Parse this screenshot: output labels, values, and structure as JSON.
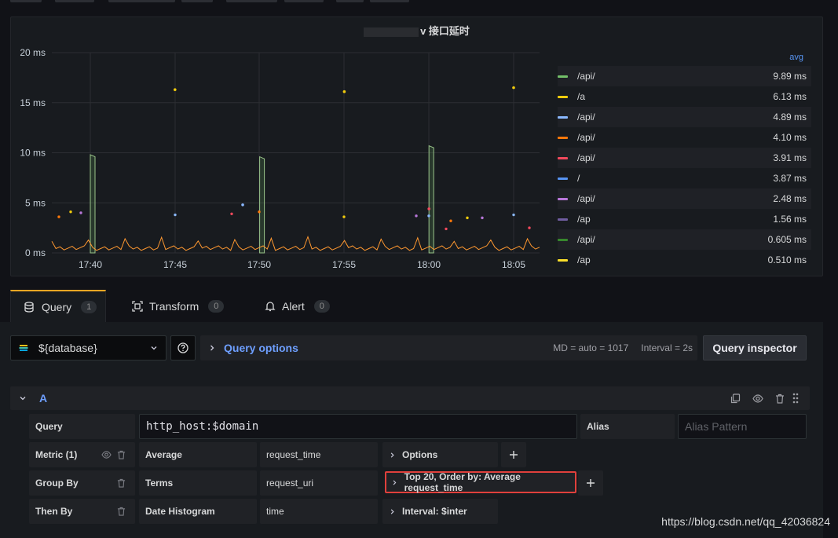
{
  "panel": {
    "title": "v 接口延时",
    "y_ticks": [
      "20 ms",
      "15 ms",
      "10 ms",
      "5 ms",
      "0 ms"
    ],
    "x_ticks": [
      "17:40",
      "17:45",
      "17:50",
      "17:55",
      "18:00",
      "18:05"
    ],
    "legend_header": "avg",
    "legend": [
      {
        "name": "/api/",
        "value": "9.89 ms",
        "color": "#73bf69"
      },
      {
        "name": "/a",
        "value": "6.13 ms",
        "color": "#f2cc0c"
      },
      {
        "name": "/api/",
        "value": "4.89 ms",
        "color": "#8ab8ff"
      },
      {
        "name": "/api/",
        "value": "4.10 ms",
        "color": "#ff780a"
      },
      {
        "name": "/api/",
        "value": "3.91 ms",
        "color": "#f2495c"
      },
      {
        "name": "/",
        "value": "3.87 ms",
        "color": "#5794f2"
      },
      {
        "name": "/api/",
        "value": "2.48 ms",
        "color": "#b877d9"
      },
      {
        "name": "/ap",
        "value": "1.56 ms",
        "color": "#705da0"
      },
      {
        "name": "/api/",
        "value": "0.605 ms",
        "color": "#37872d"
      },
      {
        "name": "/ap",
        "value": "0.510 ms",
        "color": "#fade2a"
      }
    ]
  },
  "chart_data": {
    "type": "line",
    "title": "v 接口延时",
    "xlabel": "",
    "ylabel": "",
    "ylim": [
      0,
      20
    ],
    "x_ticks": [
      "17:40",
      "17:45",
      "17:50",
      "17:55",
      "18:00",
      "18:05"
    ],
    "y_unit": "ms",
    "grid": true,
    "legend_position": "right",
    "series_avg": [
      9.89,
      6.13,
      4.89,
      4.1,
      3.91,
      3.87,
      2.48,
      1.56,
      0.605,
      0.51
    ],
    "spikes": [
      {
        "x": "17:40",
        "y": 9.8
      },
      {
        "x": "17:50",
        "y": 9.6
      },
      {
        "x": "18:00",
        "y": 10.7
      }
    ],
    "outlier_points": [
      {
        "x": "17:45",
        "y": 16.3,
        "color": "#f2cc0c"
      },
      {
        "x": "17:55",
        "y": 16.1,
        "color": "#f2cc0c"
      },
      {
        "x": "18:05",
        "y": 16.5,
        "color": "#f2cc0c"
      },
      {
        "x": "17:49",
        "y": 4.8,
        "color": "#8ab8ff"
      },
      {
        "x": "18:00",
        "y": 4.4,
        "color": "#f2495c"
      }
    ]
  },
  "tabs": [
    {
      "label": "Query",
      "count": "1",
      "icon": "database-icon"
    },
    {
      "label": "Transform",
      "count": "0",
      "icon": "transform-icon"
    },
    {
      "label": "Alert",
      "count": "0",
      "icon": "bell-icon"
    }
  ],
  "toolbar": {
    "datasource": "${database}",
    "query_options": "Query options",
    "md": "MD = auto = 1017",
    "interval": "Interval = 2s",
    "inspector": "Query inspector"
  },
  "query": {
    "ref": "A",
    "query_label": "Query",
    "query_value": "http_host:$domain",
    "alias_label": "Alias",
    "alias_placeholder": "Alias Pattern",
    "metric_label": "Metric (1)",
    "metric_type": "Average",
    "metric_field": "request_time",
    "metric_options": "Options",
    "groupby_label": "Group By",
    "groupby_type": "Terms",
    "groupby_field": "request_uri",
    "groupby_options": "Top 20, Order by: Average request_time",
    "thenby_label": "Then By",
    "thenby_type": "Date Histogram",
    "thenby_field": "time",
    "thenby_options": "Interval: $inter"
  },
  "watermark": "https://blog.csdn.net/qq_42036824",
  "colors": {
    "accent": "#5794f2",
    "highlight": "#e0403c",
    "tab_active": "#f5a623"
  }
}
